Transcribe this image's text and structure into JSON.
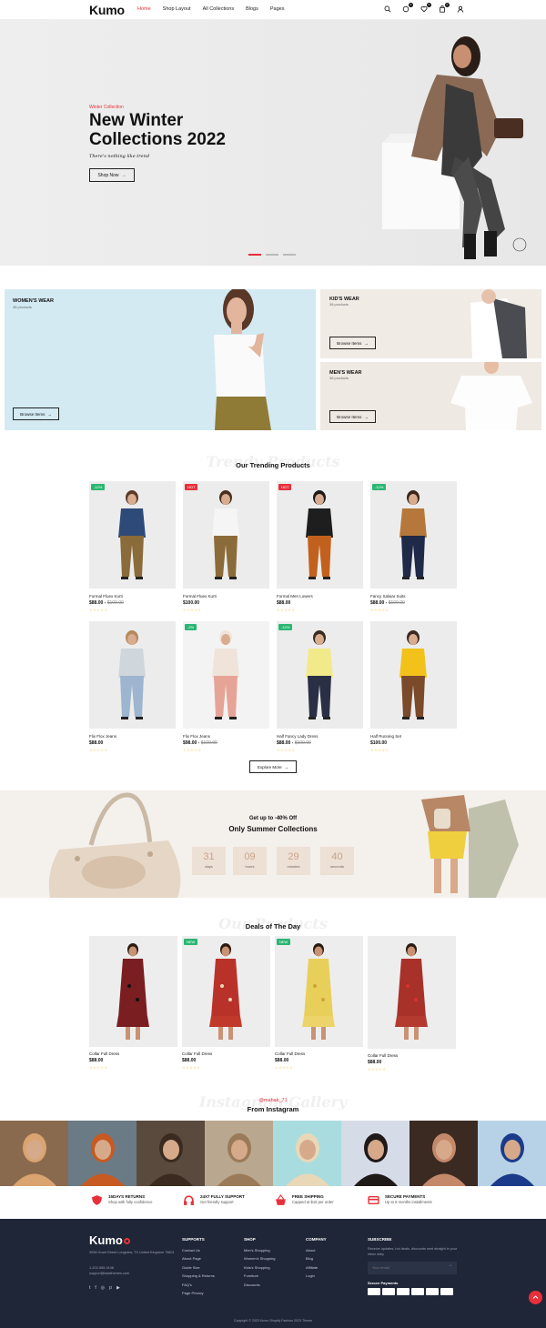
{
  "header": {
    "logo": "Kumo",
    "nav": [
      "Home",
      "Shop Layout",
      "All Collections",
      "Blogs",
      "Pages"
    ],
    "wish_count": "0",
    "cart_count": "0"
  },
  "hero": {
    "subtitle": "Winter Collection",
    "title": "New Winter Collections 2022",
    "tagline": "There's nothing like trend",
    "button": "Shop Now"
  },
  "banners": {
    "women": {
      "title": "WOMEN'S WEAR",
      "count": "38 products",
      "button": "Browse Items"
    },
    "kids": {
      "title": "KID'S WEAR",
      "count": "38 products",
      "button": "Browse Items"
    },
    "men": {
      "title": "MEN'S WEAR",
      "count": "38 products",
      "button": "Browse Items"
    }
  },
  "trending": {
    "ghost": "Trendy Products",
    "title": "Our Trending Products",
    "explore": "Explore More",
    "products": [
      {
        "name": "Formal Fluex Kurti",
        "price": "$88.00",
        "old": "$100.00",
        "badge": "-12%"
      },
      {
        "name": "Formal Fluex Kurti",
        "price": "$100.00",
        "old": "",
        "badge": "HOT"
      },
      {
        "name": "Formal Men Lowers",
        "price": "$88.00",
        "old": "",
        "badge": "HOT"
      },
      {
        "name": "Fancy Salwar Suits",
        "price": "$88.00",
        "old": "$100.00",
        "badge": "-12%"
      },
      {
        "name": "Flix Flox Jeans",
        "price": "$88.00",
        "old": "",
        "badge": ""
      },
      {
        "name": "Flix Flox Jeans",
        "price": "$98.00",
        "old": "$100.00",
        "badge": "-2%"
      },
      {
        "name": "Half Fancy Lady Dress",
        "price": "$88.00",
        "old": "$100.00",
        "badge": "-12%"
      },
      {
        "name": "Half Running Set",
        "price": "$100.00",
        "old": "",
        "badge": ""
      }
    ]
  },
  "countdown": {
    "sub": "Get up to -40% Off",
    "title": "Only Summer Collections",
    "units": [
      {
        "n": "31",
        "l": "days"
      },
      {
        "n": "09",
        "l": "hours"
      },
      {
        "n": "29",
        "l": "minutes"
      },
      {
        "n": "40",
        "l": "seconds"
      }
    ]
  },
  "deals": {
    "ghost": "Our Products",
    "title": "Deals of The Day",
    "products": [
      {
        "name": "Collar Full Dress",
        "price": "$88.00",
        "badge": ""
      },
      {
        "name": "Collar Full Dress",
        "price": "$88.00",
        "badge": "NEW"
      },
      {
        "name": "Collar Full Dress",
        "price": "$88.00",
        "badge": "NEW"
      },
      {
        "name": "Collar Full Dress",
        "price": "$88.00",
        "badge": ""
      }
    ]
  },
  "instagram": {
    "ghost": "Instagram Gallery",
    "handle": "@mahak_71",
    "title": "From Instagram"
  },
  "features": [
    {
      "title": "15DAYS RETURNS",
      "sub": "Shop with fully confidence"
    },
    {
      "title": "24X7 FULLY SUPPORT",
      "sub": "Get friendly support"
    },
    {
      "title": "FREE SHIPPING",
      "sub": "Capped at $10 per order"
    },
    {
      "title": "SECURE PAYMENTS",
      "sub": "Up to 6 months installments"
    }
  ],
  "footer": {
    "logo": "Kumo",
    "address": "3098 Grant Street Longview, TX United Kingdom 75601",
    "phone": "1-202-555-0106",
    "email": "support@kalathemes.com",
    "supports": {
      "h": "SUPPORTS",
      "items": [
        "Contact Us",
        "About Page",
        "Guide Size",
        "Shopping & Returns",
        "FAQ's",
        "Page Privacy"
      ]
    },
    "shop": {
      "h": "SHOP",
      "items": [
        "Men's Shopping",
        "Women's Shopping",
        "Kids's Shopping",
        "Furniture",
        "Discounts"
      ]
    },
    "company": {
      "h": "COMPANY",
      "items": [
        "About",
        "Blog",
        "Affiliate",
        "Login"
      ]
    },
    "subscribe": {
      "h": "SUBSCRIBE",
      "text": "Receive updates, hot deals, discounts sent straight in your inbox daily",
      "placeholder": "Your email",
      "payments": "Secure Payments"
    },
    "copyright": "Copyright © 2023 Kumo Shopify Fashion 2023 Theme"
  }
}
